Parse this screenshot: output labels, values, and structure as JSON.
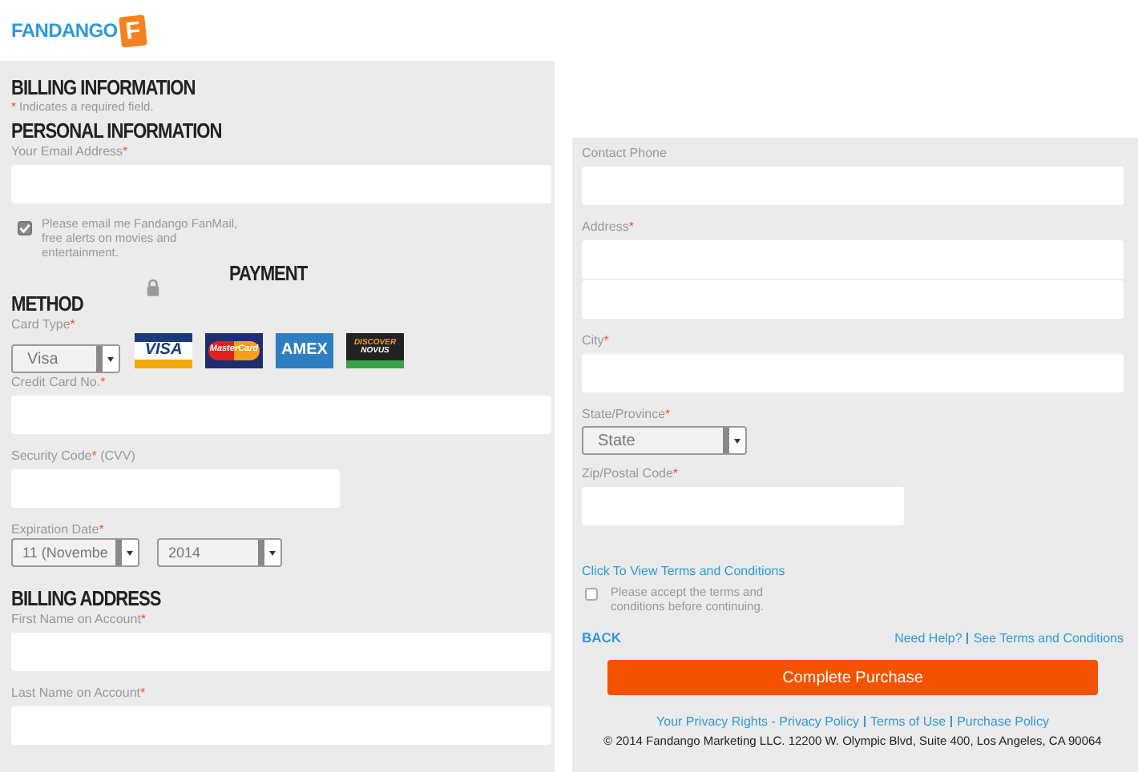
{
  "brand": {
    "name": "FANDANGO",
    "badge": "F"
  },
  "billing": {
    "title": "BILLING INFORMATION",
    "required_mark": "*",
    "required_note": "Indicates a required field."
  },
  "personal": {
    "title": "PERSONAL INFORMATION",
    "email": {
      "label": "Your Email Address",
      "required": true
    },
    "fanmail": {
      "checked": true,
      "label": "Please email me Fandango FanMail, free alerts on movies and entertainment."
    }
  },
  "payment": {
    "title_parts": [
      "PAYMENT",
      "METHOD"
    ],
    "card_type": {
      "label": "Card Type",
      "required": true,
      "value": "Visa"
    },
    "card_logos": [
      {
        "kind": "visa",
        "text": "VISA"
      },
      {
        "kind": "mastercard",
        "text": "MasterCard"
      },
      {
        "kind": "amex",
        "text": "AMEX"
      },
      {
        "kind": "discover",
        "text": "DISCOVER",
        "subtext": "NOVUS"
      }
    ],
    "card_number": {
      "label": "Credit Card No.",
      "required": true
    },
    "security_code": {
      "label": "Security Code",
      "required": true,
      "after": "(CVV)"
    },
    "expiration": {
      "label": "Expiration Date",
      "required": true,
      "month": "11 (Novembe",
      "year": "2014"
    }
  },
  "billing_address": {
    "title": "BILLING ADDRESS",
    "fields": [
      {
        "label": "First Name on Account",
        "required": true
      },
      {
        "label": "Last Name on Account",
        "required": true
      }
    ]
  },
  "contact": {
    "phone": {
      "label": "Contact Phone",
      "required": false
    },
    "address": {
      "label": "Address",
      "required": true
    },
    "city": {
      "label": "City",
      "required": true
    },
    "state": {
      "label": "State/Province",
      "required": true,
      "value": "State"
    },
    "zip": {
      "label": "Zip/Postal Code",
      "required": true
    }
  },
  "terms": {
    "link": "Click To View Terms and Conditions",
    "accept": {
      "checked": false,
      "label": "Please accept the terms and conditions before continuing."
    }
  },
  "nav": {
    "back": "BACK",
    "help_links": [
      "Need Help?",
      "See Terms and Conditions"
    ]
  },
  "submit": "Complete Purchase",
  "footer": {
    "links": [
      "Your Privacy Rights - Privacy Policy",
      "Terms of Use",
      "Purchase Policy"
    ],
    "copyright": "© 2014 Fandango Marketing LLC. 12200 W. Olympic Blvd, Suite 400, Los Angeles, CA 90064"
  }
}
